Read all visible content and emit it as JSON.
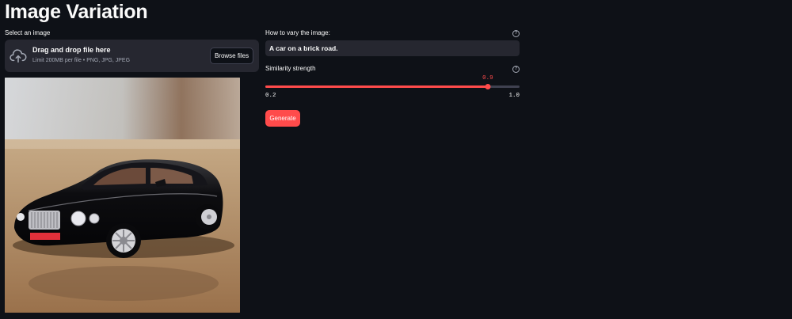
{
  "page": {
    "title": "Image Variation"
  },
  "uploader": {
    "label": "Select an image",
    "drop_text": "Drag and drop file here",
    "limit_text": "Limit 200MB per file • PNG, JPG, JPEG",
    "browse_label": "Browse files",
    "icon": "cloud-upload-icon"
  },
  "prompt": {
    "label": "How to vary the image:",
    "value": "A car on a brick road.",
    "help_icon": "?"
  },
  "slider": {
    "label": "Similarity strength",
    "help_icon": "?",
    "value": 0.9,
    "value_text": "0.9",
    "min": 0.2,
    "max": 1.0,
    "min_text": "0.2",
    "max_text": "1.0"
  },
  "generate": {
    "label": "Generate"
  },
  "colors": {
    "background": "#0e1117",
    "panel": "#262730",
    "accent": "#ff4b4b",
    "text": "#fafafa",
    "muted": "#a3a8b4"
  }
}
